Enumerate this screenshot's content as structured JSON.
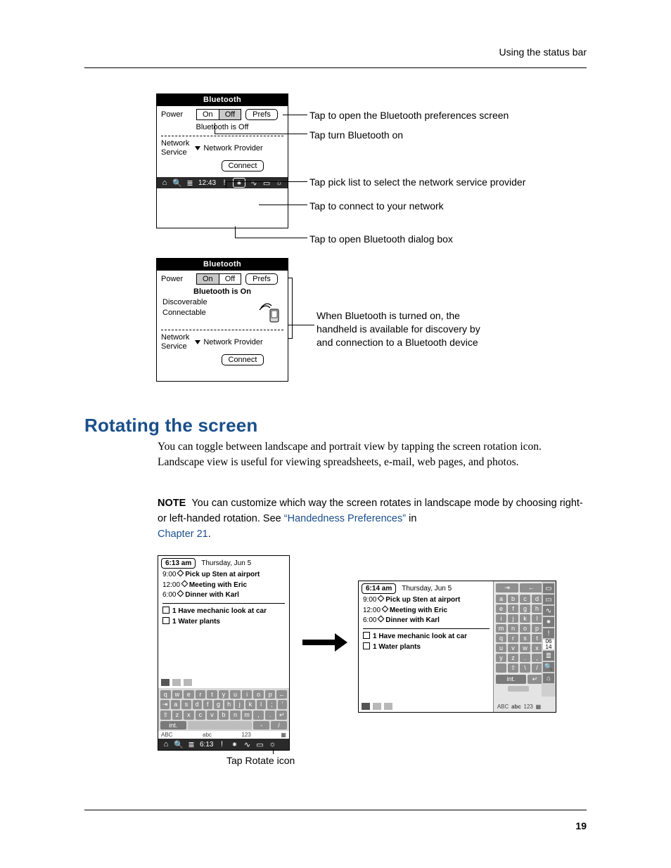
{
  "page": {
    "header_right": "Using the status bar",
    "number": "19"
  },
  "bt_off": {
    "title": "Bluetooth",
    "power_label": "Power",
    "on": "On",
    "off": "Off",
    "prefs": "Prefs",
    "status": "Bluetooth is Off",
    "net_label1": "Network",
    "net_label2": "Service",
    "np": "Network Provider",
    "connect": "Connect",
    "status_time": "12:43"
  },
  "bt_on": {
    "title": "Bluetooth",
    "power_label": "Power",
    "on": "On",
    "off": "Off",
    "prefs": "Prefs",
    "status": "Bluetooth is On",
    "disc": "Discoverable",
    "conn": "Connectable",
    "net_label1": "Network",
    "net_label2": "Service",
    "np": "Network Provider",
    "connect": "Connect"
  },
  "callouts": {
    "c1": "Tap to open the Bluetooth preferences screen",
    "c2": "Tap turn Bluetooth on",
    "c3": "Tap pick list to select the network service provider",
    "c4": "Tap to connect to your network",
    "c5": "Tap to open Bluetooth dialog box",
    "c6a": "When Bluetooth is turned on, the",
    "c6b": "handheld is available for discovery by",
    "c6c": "and connection to a Bluetooth device",
    "rotate": "Tap Rotate icon"
  },
  "section": {
    "heading": "Rotating the screen",
    "body": "You can toggle between landscape and portrait view by tapping the screen rotation icon. Landscape view is useful for viewing spreadsheets, e-mail, web pages, and photos.",
    "note_label": "NOTE",
    "note_body_1": "You can customize which way the screen rotates in landscape mode by choosing right- or left-handed rotation. See ",
    "note_link1": "“Handedness Preferences”",
    "note_body_2": " in ",
    "note_link2": "Chapter 21",
    "note_body_3": "."
  },
  "pda": {
    "time_a": "6:13 am",
    "time_b": "6:14 am",
    "date": "Thursday, Jun 5",
    "a1_time": "9:00",
    "a1": "Pick up Sten at airport",
    "a2_time": "12:00",
    "a2": "Meeting with Eric",
    "a3_time": "6:00",
    "a3": "Dinner with Karl",
    "t1": "1  Have mechanic look at car",
    "t2": "1  Water plants",
    "status_time": "6:13",
    "int": "int.",
    "abc_u": "ABC",
    "abc_l": "abc",
    "n123": "123",
    "L06": "06",
    "L14": "14",
    "kb_portrait_rows": [
      [
        "q",
        "w",
        "e",
        "r",
        "t",
        "y",
        "u",
        "i",
        "o",
        "p",
        "←"
      ],
      [
        "⇥",
        "a",
        "s",
        "d",
        "f",
        "g",
        "h",
        "j",
        "k",
        "l",
        ";",
        "'"
      ],
      [
        "⇧",
        "z",
        "x",
        "c",
        "v",
        "b",
        "n",
        "m",
        ",",
        ".",
        "↵"
      ]
    ],
    "kb_land_grid": [
      [
        "a",
        "b",
        "c",
        "d"
      ],
      [
        "e",
        "f",
        "g",
        "h"
      ],
      [
        "i",
        "j",
        "k",
        "l"
      ],
      [
        "m",
        "n",
        "o",
        "p"
      ],
      [
        "q",
        "r",
        "s",
        "t"
      ],
      [
        "u",
        "v",
        "w",
        "x"
      ],
      [
        "y",
        "z",
        ".",
        ","
      ],
      [
        " ",
        "⇧",
        "\\",
        "/"
      ]
    ]
  }
}
